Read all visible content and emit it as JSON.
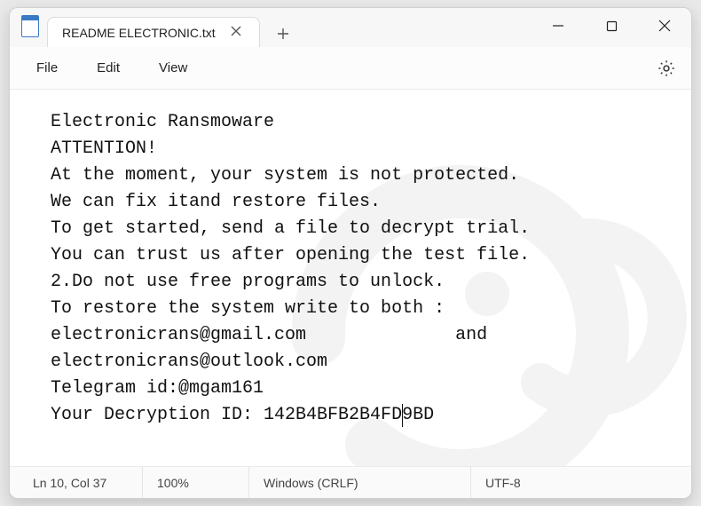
{
  "titlebar": {
    "tab_title": "README ELECTRONIC.txt"
  },
  "menubar": {
    "file": "File",
    "edit": "Edit",
    "view": "View"
  },
  "document": {
    "lines": [
      "Electronic Ransmoware",
      "ATTENTION!",
      "At the moment, your system is not protected.",
      "We can fix itand restore files.",
      "To get started, send a file to decrypt trial.",
      "You can trust us after opening the test file.",
      "2.Do not use free programs to unlock.",
      "To restore the system write to both :",
      "electronicrans@gmail.com              and",
      "electronicrans@outlook.com",
      "Telegram id:@mgam161",
      "Your Decryption ID: 142B4BFB2B4FD9BD"
    ]
  },
  "statusbar": {
    "cursor": "Ln 10, Col 37",
    "zoom": "100%",
    "line_ending": "Windows (CRLF)",
    "encoding": "UTF-8"
  }
}
